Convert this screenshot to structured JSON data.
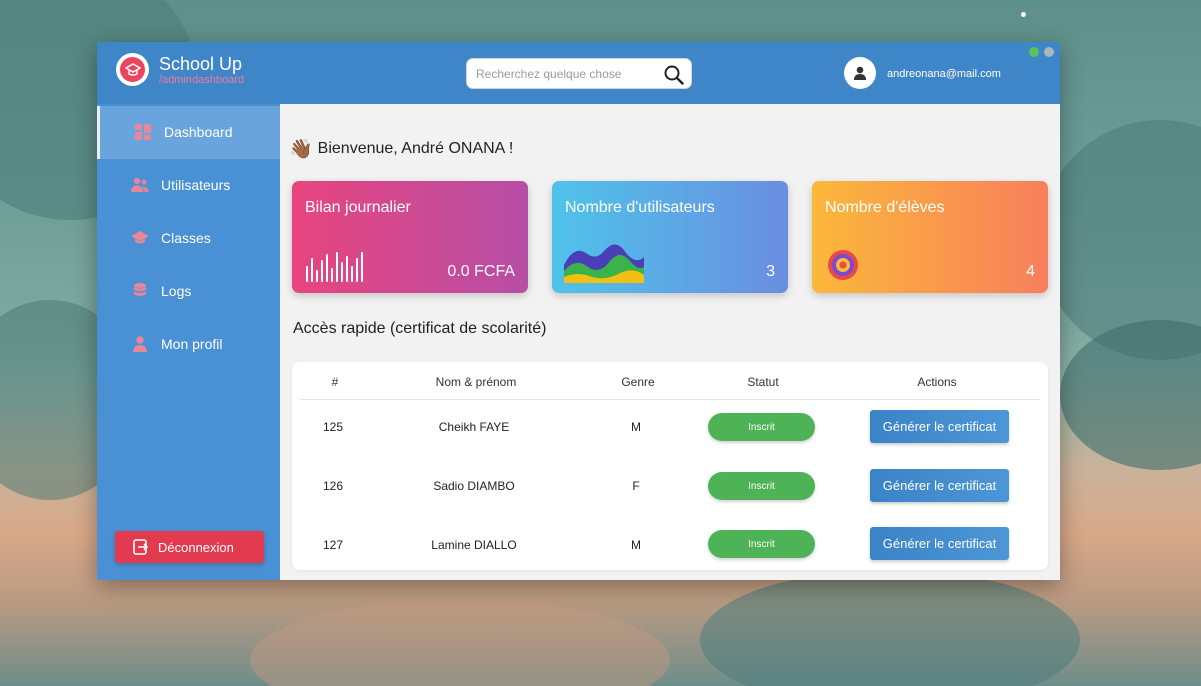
{
  "app": {
    "title": "School Up",
    "subtitle": "/admindashboard"
  },
  "search": {
    "placeholder": "Recherchez quelque chose",
    "icon": "search-icon"
  },
  "user": {
    "email": "andreonana@mail.com",
    "avatar_icon": "user-icon"
  },
  "sidebar": {
    "items": [
      {
        "label": "Dashboard",
        "icon": "dashboard-icon",
        "active": true
      },
      {
        "label": "Utilisateurs",
        "icon": "users-icon",
        "active": false
      },
      {
        "label": "Classes",
        "icon": "graduation-cap-icon",
        "active": false
      },
      {
        "label": "Logs",
        "icon": "database-icon",
        "active": false
      },
      {
        "label": "Mon profil",
        "icon": "user-icon",
        "active": false
      }
    ],
    "logout_label": "Déconnexion"
  },
  "main": {
    "welcome": "Bienvenue, André ONANA !",
    "welcome_emoji": "👋🏾",
    "cards": [
      {
        "title": "Bilan journalier",
        "value": "0.0 FCFA",
        "viz": "bars-chart-icon",
        "gradient": [
          "#e8457e",
          "#b64ea6"
        ]
      },
      {
        "title": "Nombre d'utilisateurs",
        "value": "3",
        "viz": "area-chart-icon",
        "gradient": [
          "#4fc3ea",
          "#6a8ee0"
        ]
      },
      {
        "title": "Nombre d'élèves",
        "value": "4",
        "viz": "target-icon",
        "gradient": [
          "#fbb83a",
          "#f87e5c"
        ]
      }
    ],
    "section_title": "Accès rapide (certificat de scolarité)",
    "table": {
      "headers": [
        "#",
        "Nom & prénom",
        "Genre",
        "Statut",
        "Actions"
      ],
      "rows": [
        {
          "id": "125",
          "name": "Cheikh FAYE",
          "gender": "M",
          "status": "Inscrit",
          "action": "Générer le certificat"
        },
        {
          "id": "126",
          "name": "Sadio DIAMBO",
          "gender": "F",
          "status": "Inscrit",
          "action": "Générer le certificat"
        },
        {
          "id": "127",
          "name": "Lamine DIALLO",
          "gender": "M",
          "status": "Inscrit",
          "action": "Générer le certificat"
        }
      ]
    }
  },
  "colors": {
    "topbar": "#3f86c8",
    "sidebar": "#4a90d4",
    "logout": "#e23a4e",
    "status_green": "#4db356",
    "accent_pink": "#f07a9a"
  }
}
